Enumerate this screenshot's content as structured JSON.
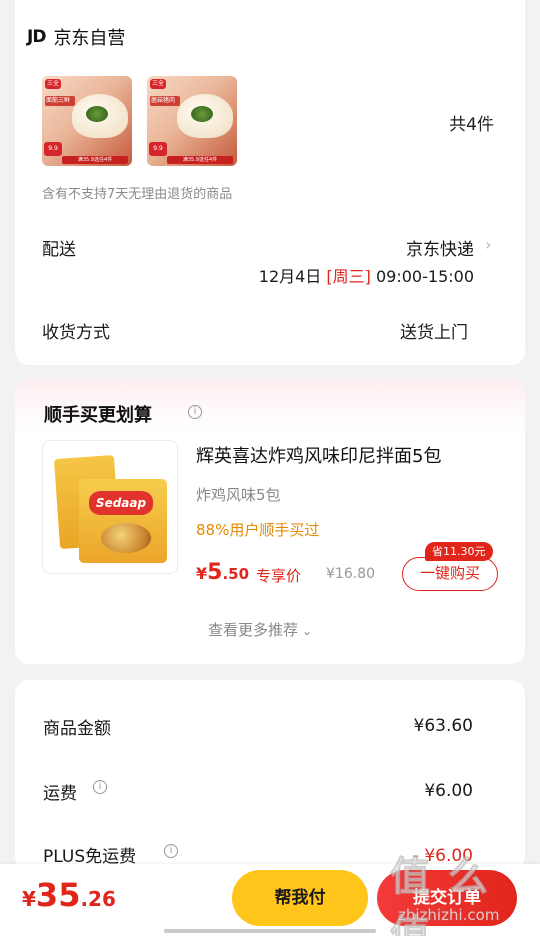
{
  "store": {
    "logo": "JD",
    "name": "京东自营"
  },
  "items": {
    "thumbnails": [
      {
        "badge": "三全",
        "tag": "面筋三鲜",
        "price": "9.9",
        "strip": "满35.9选任4件"
      },
      {
        "badge": "三全",
        "tag": "菌菇猪肉",
        "price": "9.9",
        "strip": "满35.9选任4件"
      }
    ],
    "count": "共4件",
    "non_return_notice": "含有不支持7天无理由退货的商品"
  },
  "delivery": {
    "label": "配送",
    "carrier": "京东快递",
    "date": "12月4日",
    "weekday": "[周三]",
    "time": "09:00-15:00"
  },
  "receive": {
    "label": "收货方式",
    "value": "送货上门"
  },
  "upsell": {
    "title": "顺手买更划算",
    "product": {
      "image_logo": "Sedaap",
      "name": "辉英喜达炸鸡风味印尼拌面5包",
      "spec": "炸鸡风味5包",
      "social_proof": "88%用户顺手买过",
      "price_currency": "¥",
      "price_int": "5",
      "price_dec": ".50",
      "price_label": "专享价",
      "original_price": "¥16.80",
      "save_badge": "省11.30元",
      "buy_label": "一键购买"
    },
    "more_label": "查看更多推荐"
  },
  "summary": {
    "goods_label": "商品金额",
    "goods_value": "¥63.60",
    "shipping_label": "运费",
    "shipping_value": "¥6.00",
    "plus_label": "PLUS免运费",
    "plus_value": "- ¥6.00"
  },
  "footer": {
    "total_currency": "¥",
    "total_int": "35",
    "total_dec": ".26",
    "help_pay_label": "帮我付",
    "pay_label": "提交订单"
  },
  "watermark": {
    "main": "值 么 值",
    "sub": "zhizhizhi.com"
  },
  "colors": {
    "accent": "#e1251b",
    "help_button": "#ffc51a",
    "social_proof": "#e68a00"
  }
}
